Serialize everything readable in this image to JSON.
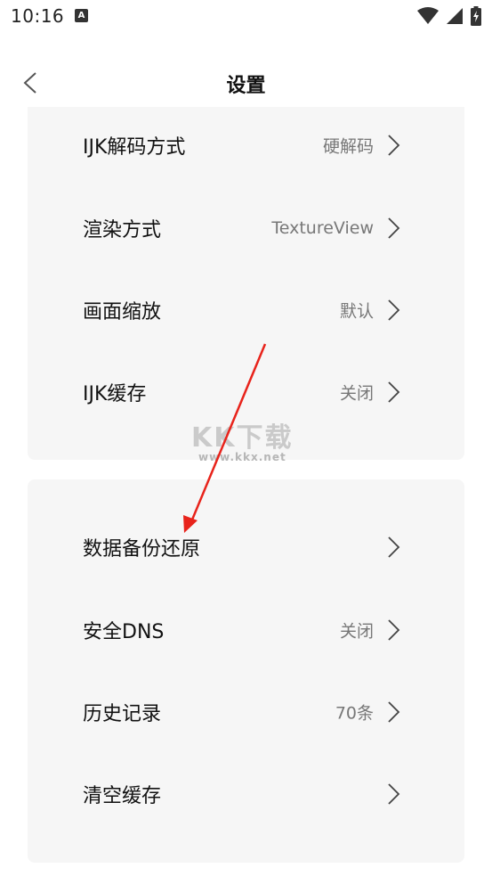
{
  "status_bar": {
    "time": "10:16",
    "notification_icon": "A"
  },
  "header": {
    "title": "设置"
  },
  "section_1": {
    "items": [
      {
        "label": "IJK解码方式",
        "value": "硬解码"
      },
      {
        "label": "渲染方式",
        "value": "TextureView"
      },
      {
        "label": "画面缩放",
        "value": "默认"
      },
      {
        "label": "IJK缓存",
        "value": "关闭"
      }
    ]
  },
  "section_2": {
    "items": [
      {
        "label": "数据备份还原",
        "value": ""
      },
      {
        "label": "安全DNS",
        "value": "关闭"
      },
      {
        "label": "历史记录",
        "value": "70条"
      },
      {
        "label": "清空缓存",
        "value": ""
      }
    ]
  },
  "watermark": {
    "logo": "KK下载",
    "url": "www.kkx.net"
  },
  "colors": {
    "card_background": "#f6f6f6",
    "annotation_arrow": "#e8231b"
  }
}
